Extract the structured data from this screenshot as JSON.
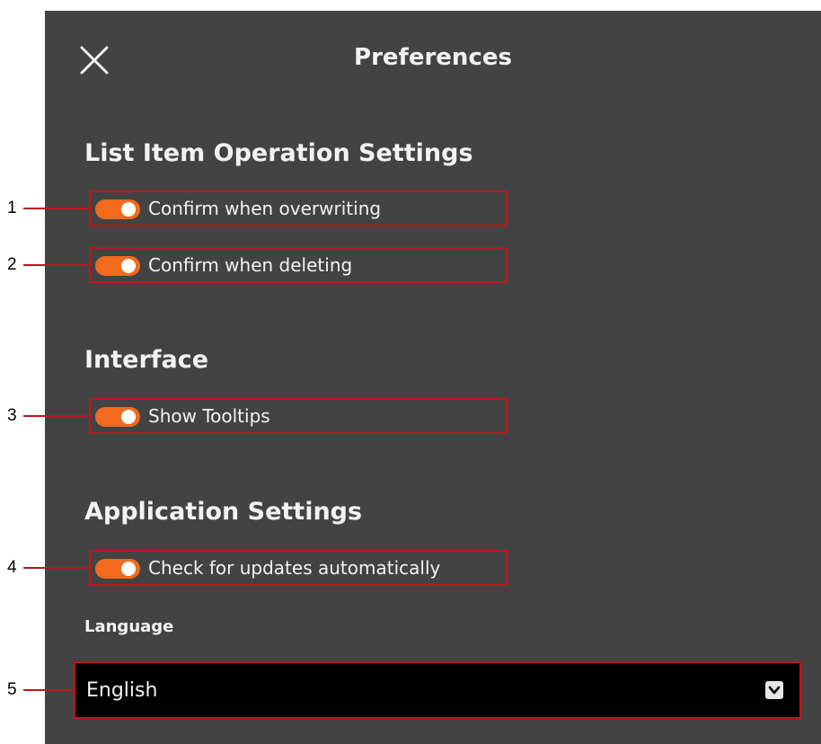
{
  "dialog": {
    "title": "Preferences",
    "close_icon": "close-icon"
  },
  "sections": {
    "list_item": {
      "heading": "List Item Operation Settings",
      "confirm_overwrite": {
        "label": "Confirm when overwriting",
        "enabled": true
      },
      "confirm_delete": {
        "label": "Confirm when deleting",
        "enabled": true
      }
    },
    "interface": {
      "heading": "Interface",
      "show_tooltips": {
        "label": "Show Tooltips",
        "enabled": true
      }
    },
    "application": {
      "heading": "Application Settings",
      "check_updates": {
        "label": "Check for updates automatically",
        "enabled": true
      },
      "language_label": "Language",
      "language_value": "English",
      "dropdown_icon": "chevron-down-icon"
    }
  },
  "callouts": [
    "1",
    "2",
    "3",
    "4",
    "5"
  ],
  "colors": {
    "panel_background": "#434343",
    "toggle_on": "#f26a1e",
    "callout_highlight": "#c0141b",
    "select_background": "#000000"
  }
}
